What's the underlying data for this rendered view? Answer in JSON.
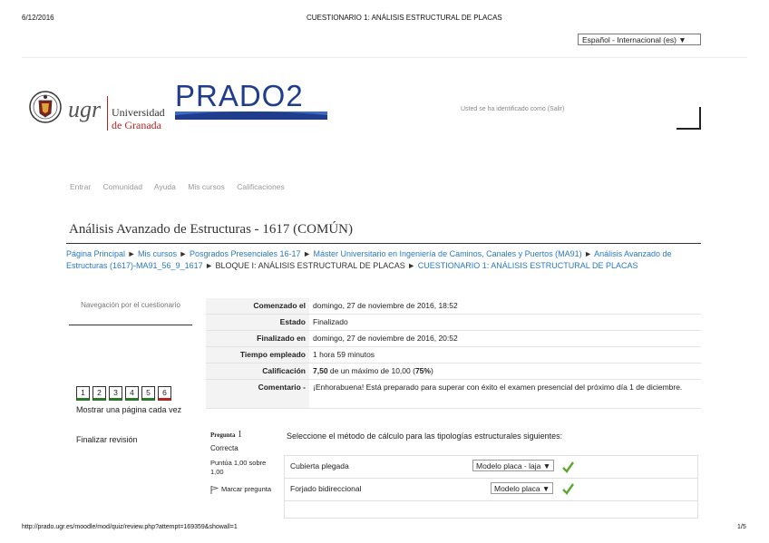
{
  "print_header": {
    "date": "6/12/2016",
    "title": "CUESTIONARIO 1: ANÁLISIS ESTRUCTURAL DE PLACAS"
  },
  "language_select": {
    "value": "Español - Internacional (es) ▼"
  },
  "logo": {
    "ugr_text": "ugr",
    "university_line1": "Universidad",
    "university_line2": "de Granada",
    "prado": "PRADO2"
  },
  "login_info": "Usted se ha identificado como (Salir)",
  "nav": {
    "items": [
      "Entrar",
      "Comunidad",
      "Ayuda",
      "Mis cursos",
      "Calificaciones"
    ]
  },
  "course": {
    "title": "Análisis Avanzado de Estructuras - 1617 (COMÚN)"
  },
  "breadcrumb": {
    "items": [
      "Página Principal",
      "Mis cursos",
      "Posgrados Presenciales 16-17",
      "Máster Universitario en Ingeniería de Caminos, Canales y Puertos (MA91)",
      "Análisis Avanzado de Estructuras (1617)-MA91_56_9_1617",
      "BLOQUE I: ANÁLISIS ESTRUCTURAL DE PLACAS",
      "CUESTIONARIO 1: ANÁLISIS ESTRUCTURAL DE PLACAS"
    ],
    "separator": "►"
  },
  "quiz_nav": {
    "title": "Navegación por el cuestionario",
    "buttons": [
      "1",
      "2",
      "3",
      "4",
      "5",
      "6"
    ],
    "show_one_page": "Mostrar una página cada vez",
    "finish_review": "Finalizar revisión"
  },
  "summary": [
    {
      "label": "Comenzado el",
      "value": "domingo, 27 de noviembre de 2016, 18:52"
    },
    {
      "label": "Estado",
      "value": "Finalizado"
    },
    {
      "label": "Finalizado en",
      "value": "domingo, 27 de noviembre de 2016, 20:52"
    },
    {
      "label": "Tiempo empleado",
      "value": "1 hora 59 minutos"
    },
    {
      "label": "Calificación",
      "value_bold": "7,50",
      "value_mid": " de un máximo de 10,00 (",
      "value_pct": "75%",
      "value_end": ")"
    },
    {
      "label": "Comentario -",
      "value": "¡Enhorabuena! Está preparado para superar con éxito el examen presencial del próximo día 1 de diciembre."
    }
  ],
  "question": {
    "title_prefix": "Pregunta",
    "number": "1",
    "state": "Correcta",
    "score": "Puntúa 1,00 sobre 1,00",
    "flag": "Marcar pregunta",
    "text": "Seleccione el método de cálculo para las tipologías estructurales siguientes:",
    "rows": [
      {
        "label": "Cubierta plegada",
        "selected": "Modelo placa - laja ▼"
      },
      {
        "label": "Forjado bidireccional",
        "selected": "Modelo placa ▼"
      }
    ]
  },
  "footer": {
    "url": "http://prado.ugr.es/moodle/mod/quiz/review.php?attempt=169359&showall=1",
    "page": "1/5"
  },
  "colors": {
    "link": "#2a79c2",
    "ugr_red": "#b3261e",
    "prado_blue": "#1f3d8c",
    "check_green": "#5aa832"
  }
}
